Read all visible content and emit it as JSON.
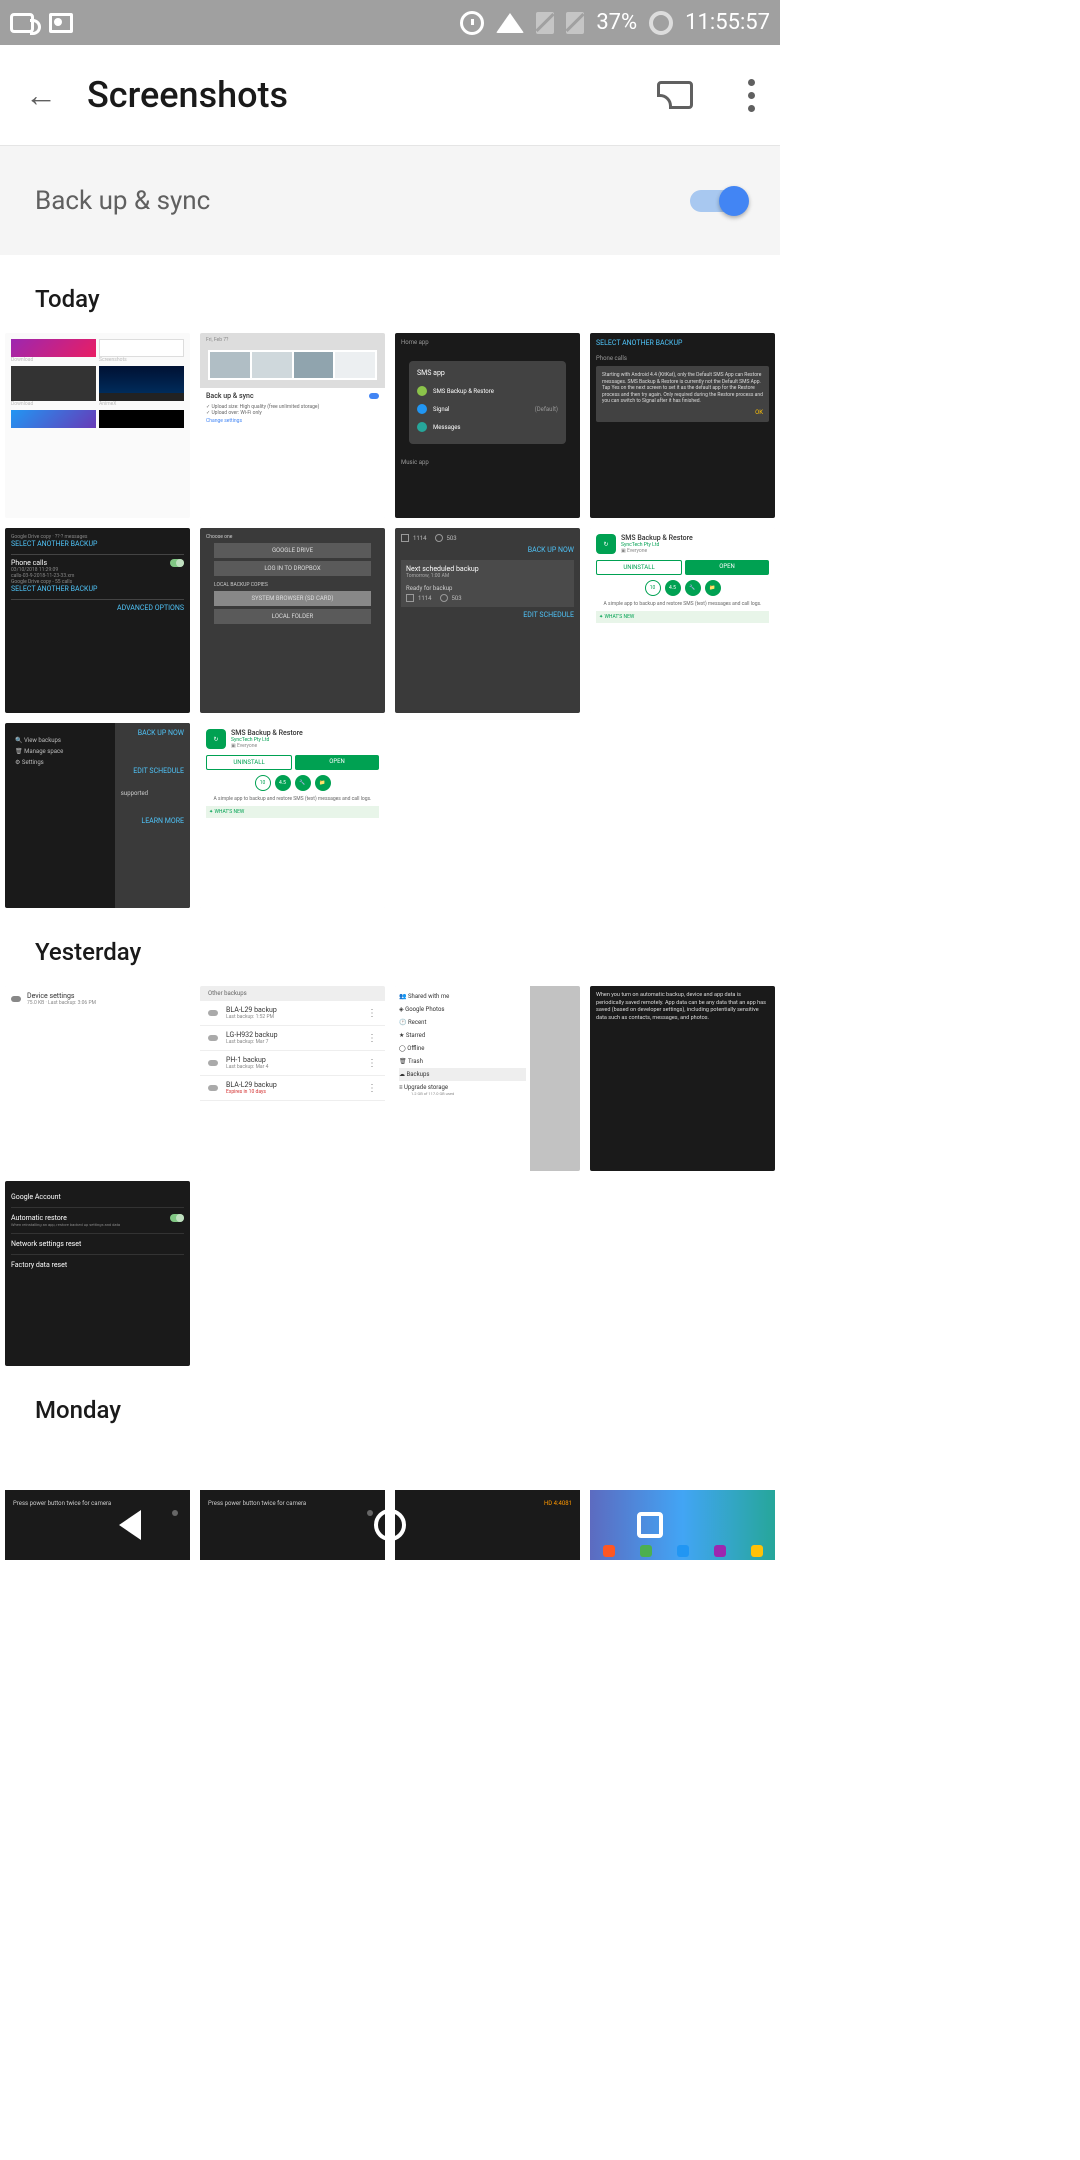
{
  "statusBar": {
    "battery": "37%",
    "time": "11:55:57"
  },
  "appBar": {
    "title": "Screenshots"
  },
  "backupBar": {
    "label": "Back up & sync"
  },
  "sections": {
    "today": "Today",
    "yesterday": "Yesterday",
    "monday": "Monday"
  },
  "thumbs": {
    "t1": {
      "download": "Download",
      "screenshots": "Screenshots",
      "animex": "AnimeX"
    },
    "t2": {
      "date": "Fri, Feb 7?",
      "title": "Back up & sync",
      "l1": "Upload size: High quality (free unlimited storage)",
      "l2": "Upload over: Wi-Fi only",
      "change": "Change settings"
    },
    "t3": {
      "title": "SMS app",
      "r1": "SMS Backup & Restore",
      "r2": "Signal",
      "r2r": "(Default)",
      "r3": "Messages"
    },
    "t4": {
      "link": "SELECT ANOTHER BACKUP",
      "title": "Phone calls",
      "body": "Starting with Android 4.4 (KitKat), only the Default SMS App can Restore messages. SMS Backup & Restore is currently not the Default SMS App. Tap Yes on the next screen to set it as the default app for the Restore process and then try again. Only required during the Restore process and you can switch to Signal after it has finished.",
      "ok": "OK"
    },
    "t5": {
      "l1": "SELECT ANOTHER BACKUP",
      "t": "Phone calls",
      "d1": "03/10/2018 11:29:09",
      "d2": "calls-03-9-2018-11-23-33.xm",
      "d3": "Google Drive copy - 55 calls",
      "l2": "SELECT ANOTHER BACKUP",
      "adv": "ADVANCED OPTIONS"
    },
    "t6": {
      "b1": "GOOGLE DRIVE",
      "b2": "LOG IN TO DROPBOX",
      "l": "LOCAL BACKUP COPIES",
      "b3": "SYSTEM BROWSER (SD CARD)",
      "b4": "LOCAL FOLDER"
    },
    "t7": {
      "n1": "1114",
      "n2": "503",
      "bk": "BACK UP NOW",
      "sch": "Next scheduled backup",
      "tom": "Tomorrow, 1:00 AM",
      "ready": "Ready for backup",
      "edit": "EDIT SCHEDULE"
    },
    "t8": {
      "title": "SMS Backup & Restore",
      "sub": "SyncTech Pty Ltd",
      "ev": "Everyone",
      "un": "UNINSTALL",
      "op": "OPEN",
      "r": "10",
      "s": "4.5",
      "desc": "A simple app to backup and restore SMS (text) messages and call logs.",
      "new": "WHAT'S NEW"
    },
    "t9": {
      "m1": "View backups",
      "m2": "Manage space",
      "m3": "Settings",
      "r1": "BACK UP NOW",
      "r2": "EDIT SCHEDULE",
      "sup": "supported",
      "lm": "LEARN MORE"
    },
    "y1": {
      "t": "Device settings",
      "s": "75.0 KB · Last backup: 3:06 PM"
    },
    "y2": {
      "h": "Other backups",
      "r1": "BLA-L29 backup",
      "r1s": "Last backup: 1:52 PM",
      "r2": "LG-H932 backup",
      "r2s": "Last backup: Mar 7",
      "r3": "PH-1 backup",
      "r3s": "Last backup: Mar 4",
      "r4": "BLA-L29 backup",
      "r4s": "Expires in 10 days"
    },
    "y3": {
      "m1": "Shared with me",
      "m2": "Google Photos",
      "m3": "Recent",
      "m4": "Starred",
      "m5": "Offline",
      "m6": "Trash",
      "m7": "Backups",
      "m8": "Upgrade storage",
      "m8s": "1.2 GB of 117.0 GB used"
    },
    "y4": {
      "body": "When you turn on automatic backup, device and app data is periodically saved remotely. App data can be any data that an app has saved (based on developer settings), including potentially sensitive data such as contacts, messages, and photos."
    },
    "y5": {
      "m1": "Google Account",
      "m2": "Automatic restore",
      "m3": "Network settings reset",
      "m4": "Factory data reset"
    },
    "m1": {
      "t": "Press power button twice for camera"
    },
    "m3": {
      "t": "HD 4:4081"
    }
  }
}
